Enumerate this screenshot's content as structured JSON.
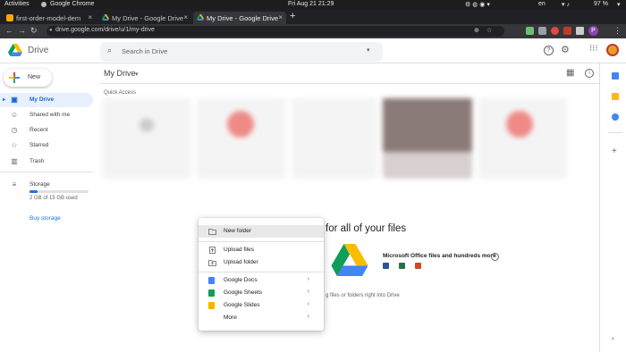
{
  "os_bar": {
    "activities": "Activities",
    "app_name": "Google Chrome",
    "clock": "Fri Aug 21  21:29",
    "language": "en",
    "battery": "97 %"
  },
  "browser": {
    "tabs": [
      {
        "title": "first-order-model-dem",
        "active": false
      },
      {
        "title": "My Drive - Google Drive",
        "active": false
      },
      {
        "title": "My Drive - Google Drive",
        "active": true
      }
    ],
    "new_tab": "+",
    "url": "drive.google.com/drive/u/1/my-drive",
    "profile_initial": "P"
  },
  "drive": {
    "logo_text": "Drive",
    "search_placeholder": "Search in Drive",
    "new_button": "New",
    "breadcrumb": "My Drive",
    "quick_access": "Quick Access",
    "sidebar": [
      {
        "label": "My Drive",
        "icon": "my-drive-icon",
        "selected": true
      },
      {
        "label": "Shared with me",
        "icon": "people-icon",
        "selected": false
      },
      {
        "label": "Recent",
        "icon": "clock-icon",
        "selected": false
      },
      {
        "label": "Starred",
        "icon": "star-icon",
        "selected": false
      },
      {
        "label": "Trash",
        "icon": "trash-icon",
        "selected": false
      }
    ],
    "storage_label": "Storage",
    "storage_text": "2 GB of 15 GB used",
    "storage_fraction": 0.13,
    "buy_storage": "Buy storage",
    "empty_heading": "for all of your files",
    "office_text": "Microsoft Office files and hundreds more",
    "drag_hint": "g files or folders right into Drive"
  },
  "menu": {
    "items": [
      {
        "label": "New folder",
        "icon": "folder-plus-icon",
        "submenu": false
      },
      {
        "label": "Upload files",
        "icon": "file-upload-icon",
        "submenu": false
      },
      {
        "label": "Upload folder",
        "icon": "folder-upload-icon",
        "submenu": false
      },
      {
        "label": "Google Docs",
        "icon": "docs-icon",
        "submenu": true
      },
      {
        "label": "Google Sheets",
        "icon": "sheets-icon",
        "submenu": true
      },
      {
        "label": "Google Slides",
        "icon": "slides-icon",
        "submenu": true
      },
      {
        "label": "More",
        "icon": "",
        "submenu": true
      }
    ]
  },
  "colors": {
    "accent_blue": "#1a73e8",
    "selected_bg": "#e8f0fe",
    "docs": "#4285f4",
    "sheets": "#0f9d58",
    "slides": "#f4b400"
  }
}
